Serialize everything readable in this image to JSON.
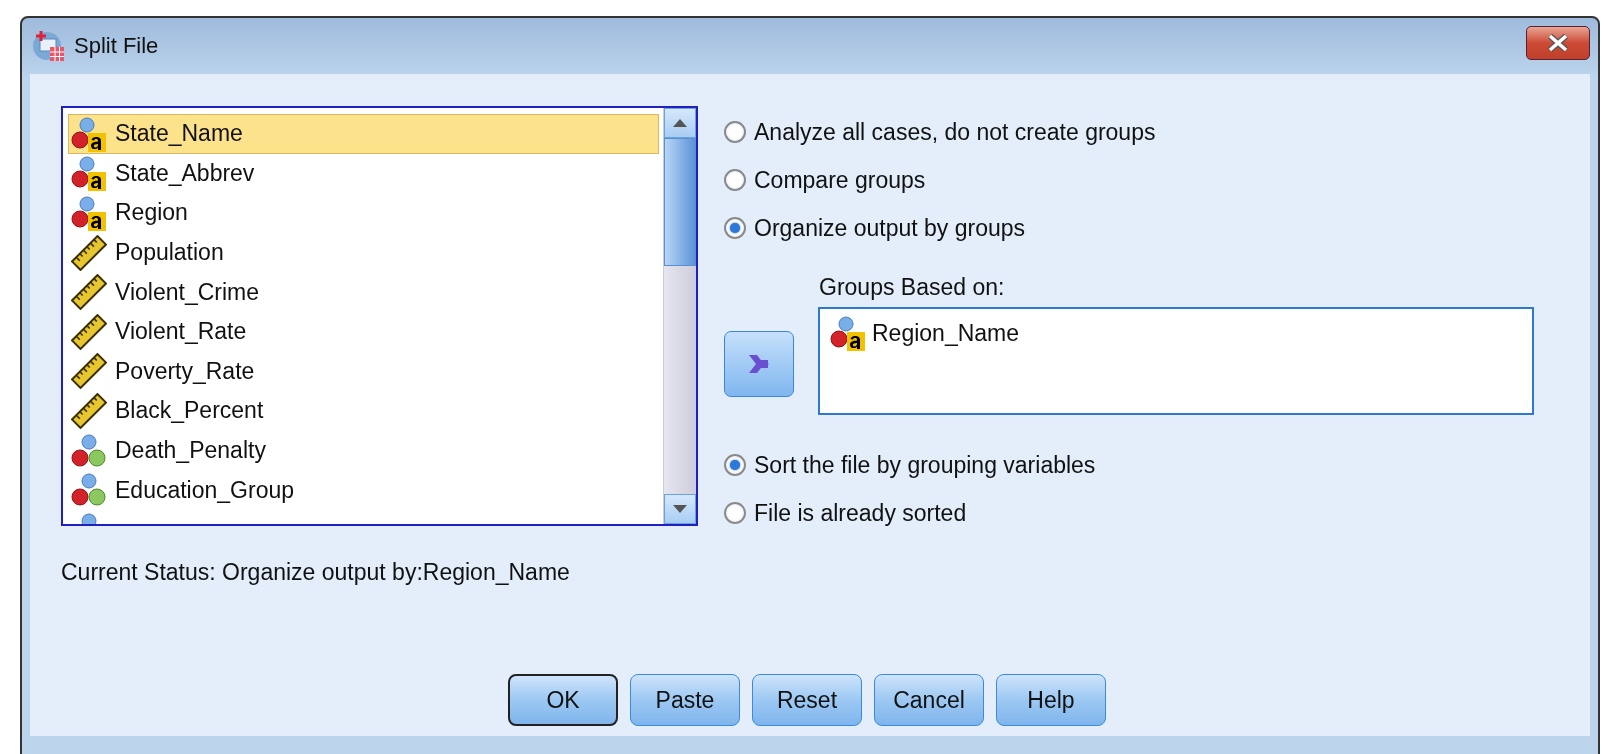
{
  "window": {
    "title": "Split File"
  },
  "variables": [
    {
      "name": "State_Name",
      "kind": "string",
      "selected": true
    },
    {
      "name": "State_Abbrev",
      "kind": "string",
      "selected": false
    },
    {
      "name": "Region",
      "kind": "string",
      "selected": false
    },
    {
      "name": "Population",
      "kind": "scale",
      "selected": false
    },
    {
      "name": "Violent_Crime",
      "kind": "scale",
      "selected": false
    },
    {
      "name": "Violent_Rate",
      "kind": "scale",
      "selected": false
    },
    {
      "name": "Poverty_Rate",
      "kind": "scale",
      "selected": false
    },
    {
      "name": "Black_Percent",
      "kind": "scale",
      "selected": false
    },
    {
      "name": "Death_Penalty",
      "kind": "nominal",
      "selected": false
    },
    {
      "name": "Education_Group",
      "kind": "nominal",
      "selected": false
    },
    {
      "kind": "nominal",
      "selected": false
    }
  ],
  "mode_options": [
    {
      "label": "Analyze all cases, do not create groups",
      "selected": false
    },
    {
      "label": "Compare groups",
      "selected": false
    },
    {
      "label": "Organize output by groups",
      "selected": true
    }
  ],
  "groups_based_on": {
    "label": "Groups Based on:",
    "items": [
      {
        "name": "Region_Name",
        "kind": "string"
      }
    ]
  },
  "sort_options": [
    {
      "label": "Sort the file by grouping variables",
      "selected": true
    },
    {
      "label": "File is already sorted",
      "selected": false
    }
  ],
  "current_status": "Current Status: Organize output by:Region_Name",
  "buttons": [
    {
      "label": "OK",
      "default": true
    },
    {
      "label": "Paste",
      "default": false
    },
    {
      "label": "Reset",
      "default": false
    },
    {
      "label": "Cancel",
      "default": false
    },
    {
      "label": "Help",
      "default": false
    }
  ]
}
